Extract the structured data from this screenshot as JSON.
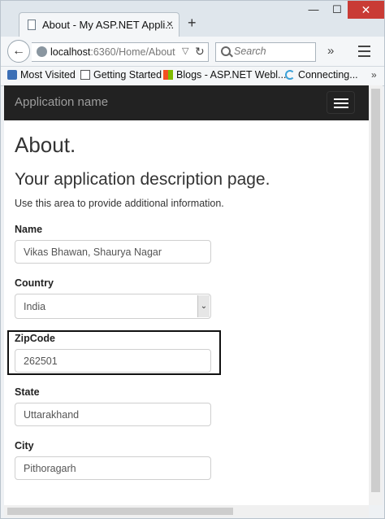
{
  "browser": {
    "tab_title": "About - My ASP.NET Appli...",
    "tab_close": "×",
    "new_tab": "+",
    "window_buttons": {
      "minimize": "—",
      "maximize": "☐",
      "close": "✕"
    },
    "url_host": "localhost",
    "url_rest": ":6360/Home/About",
    "search_placeholder": "Search",
    "bookmarks": [
      {
        "label": "Most Visited",
        "icon": "bookmarks-star-icon"
      },
      {
        "label": "Getting Started",
        "icon": "page-icon"
      },
      {
        "label": "Blogs - ASP.NET Webl...",
        "icon": "microsoft-logo-icon"
      },
      {
        "label": "Connecting...",
        "icon": "loading-icon"
      }
    ]
  },
  "app": {
    "brand": "Application name",
    "heading": "About.",
    "subheading": "Your application description page.",
    "lead": "Use this area to provide additional information.",
    "fields": {
      "name": {
        "label": "Name",
        "value": "Vikas Bhawan, Shaurya Nagar"
      },
      "country": {
        "label": "Country",
        "value": "India"
      },
      "zipcode": {
        "label": "ZipCode",
        "value": "262501"
      },
      "state": {
        "label": "State",
        "value": "Uttarakhand"
      },
      "city": {
        "label": "City",
        "value": "Pithoragarh"
      }
    }
  },
  "colors": {
    "navbar_bg": "#222222",
    "brand_text": "#9d9d9d",
    "close_button": "#c93b35",
    "highlight_border": "#111111"
  }
}
